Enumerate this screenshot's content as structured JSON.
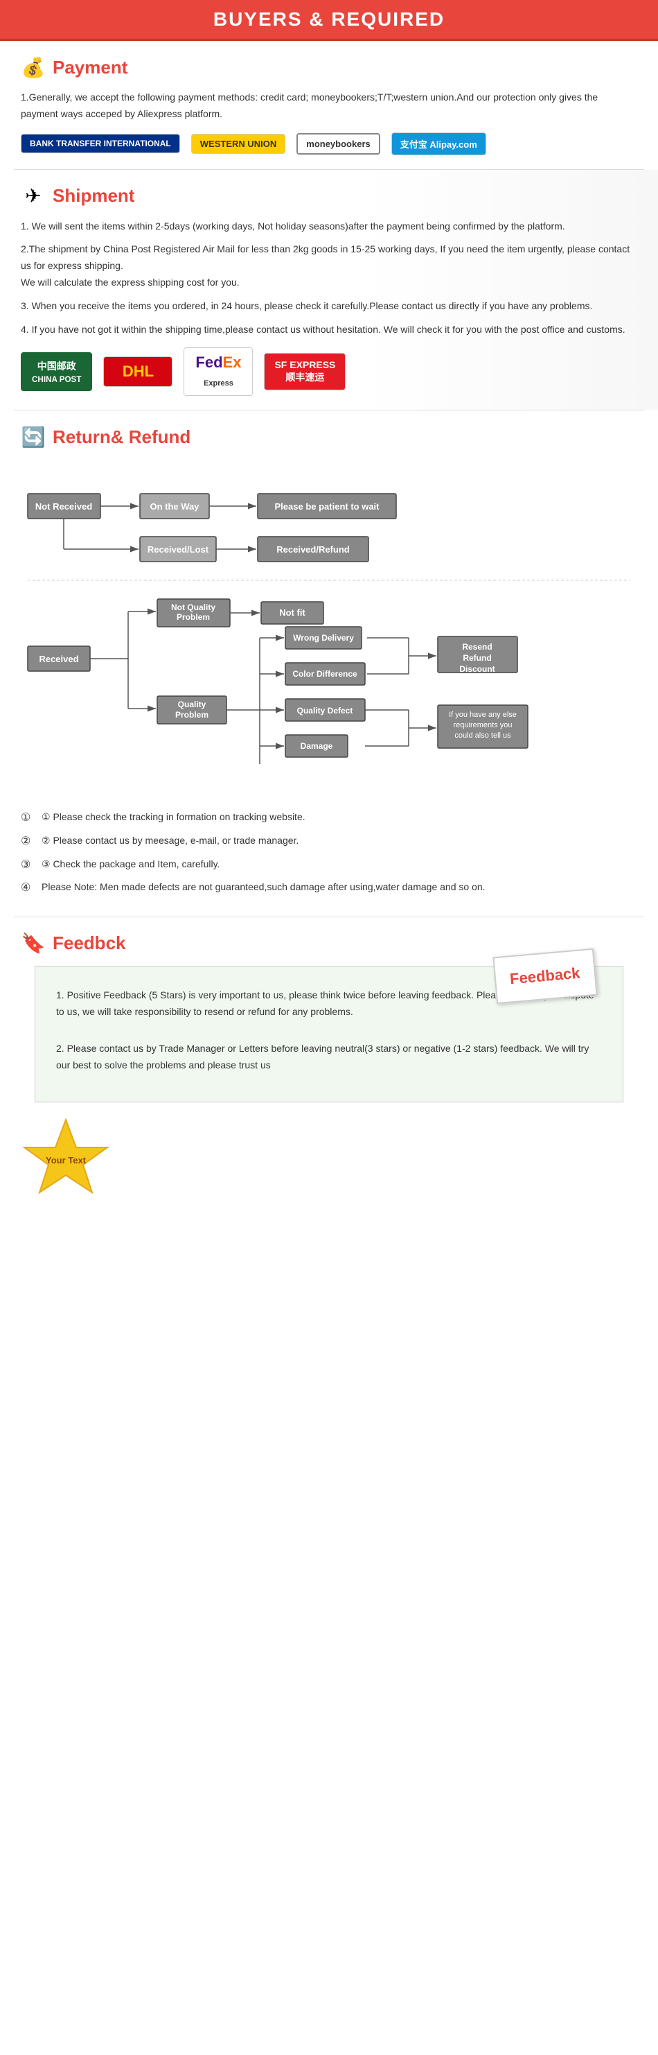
{
  "header": {
    "title": "BUYERS & REQUIRED"
  },
  "payment": {
    "section_title": "Payment",
    "icon": "💰",
    "description": "1.Generally, we accept the following payment methods: credit card; moneybookers;T/T;western union.And our protection only gives the payment ways acceped by Aliexpress platform.",
    "logos": [
      {
        "id": "bank-transfer",
        "label": "BANK TRANSFER INTERNATIONAL",
        "class": "bank-transfer"
      },
      {
        "id": "western-union",
        "label": "WESTERN UNION",
        "class": "western-union"
      },
      {
        "id": "moneybookers",
        "label": "moneybookers",
        "class": "moneybookers"
      },
      {
        "id": "alipay",
        "label": "支付宝 Alipay.com",
        "class": "alipay"
      }
    ]
  },
  "shipment": {
    "section_title": "Shipment",
    "icon": "✈",
    "paragraphs": [
      "1. We will sent the items within 2-5days (working days, Not holiday seasons)after the payment being confirmed by the platform.",
      "2.The shipment by China Post Registered Air Mail for less than 2kg goods in 15-25 working days, If  you need the item urgently, please contact us for express shipping.\nWe will calculate the express shipping cost for you.",
      "3. When you receive the items you ordered, in 24 hours, please check it carefully.Please contact us directly if you have any problems.",
      "4. If you have not got it within the shipping time,please contact us without hesitation. We will check it for you with the post office and customs."
    ],
    "logos": [
      {
        "id": "china-post",
        "label": "中国邮政 CHINA POST",
        "class": "china-post"
      },
      {
        "id": "dhl",
        "label": "DHL",
        "class": "dhl"
      },
      {
        "id": "fedex",
        "label": "FedEx Express",
        "class": "fedex"
      },
      {
        "id": "sf-express",
        "label": "SF EXPRESS 顺丰速运",
        "class": "sf-express"
      }
    ]
  },
  "return_refund": {
    "section_title": "Return& Refund",
    "icon": "📦",
    "flowchart": {
      "nodes": [
        {
          "id": "not-received",
          "label": "Not Received"
        },
        {
          "id": "on-the-way",
          "label": "On the Way"
        },
        {
          "id": "please-wait",
          "label": "Please be patient to wait"
        },
        {
          "id": "received-lost",
          "label": "Received/Lost"
        },
        {
          "id": "received-refund",
          "label": "Received/Refund"
        },
        {
          "id": "received",
          "label": "Received"
        },
        {
          "id": "not-quality",
          "label": "Not Quality Problem"
        },
        {
          "id": "quality-problem",
          "label": "Quality Problem"
        },
        {
          "id": "not-fit",
          "label": "Not fit"
        },
        {
          "id": "wrong-delivery",
          "label": "Wrong Delivery"
        },
        {
          "id": "color-diff",
          "label": "Color Difference"
        },
        {
          "id": "quality-defect",
          "label": "Quality Defect"
        },
        {
          "id": "damage",
          "label": "Damage"
        },
        {
          "id": "resend",
          "label": "Resend Refund Discount"
        },
        {
          "id": "else",
          "label": "If you have any else requirements you could also tell us"
        }
      ]
    },
    "notes": [
      "① Please check the tracking in formation on tracking website.",
      "② Please contact us by meesage, e-mail, or trade manager.",
      "③ Check the package and Item, carefully.",
      "④ Please Note: Men made defects  are not guaranteed,such damage after using,water damage and so on."
    ]
  },
  "feedback": {
    "section_title": "Feedbck",
    "icon": "📦",
    "note_label": "Feedback",
    "paragraphs": [
      "1. Positive Feedback (5 Stars) is very important to us, please think twice before leaving feedback. Please do not open dispute to us,   we will take responsibility to resend or refund for any problems.",
      "2. Please contact us by Trade Manager or Letters before leaving neutral(3 stars) or negative (1-2 stars) feedback. We will try our best to solve the problems and please trust us"
    ],
    "badge_text": "Your Text"
  }
}
